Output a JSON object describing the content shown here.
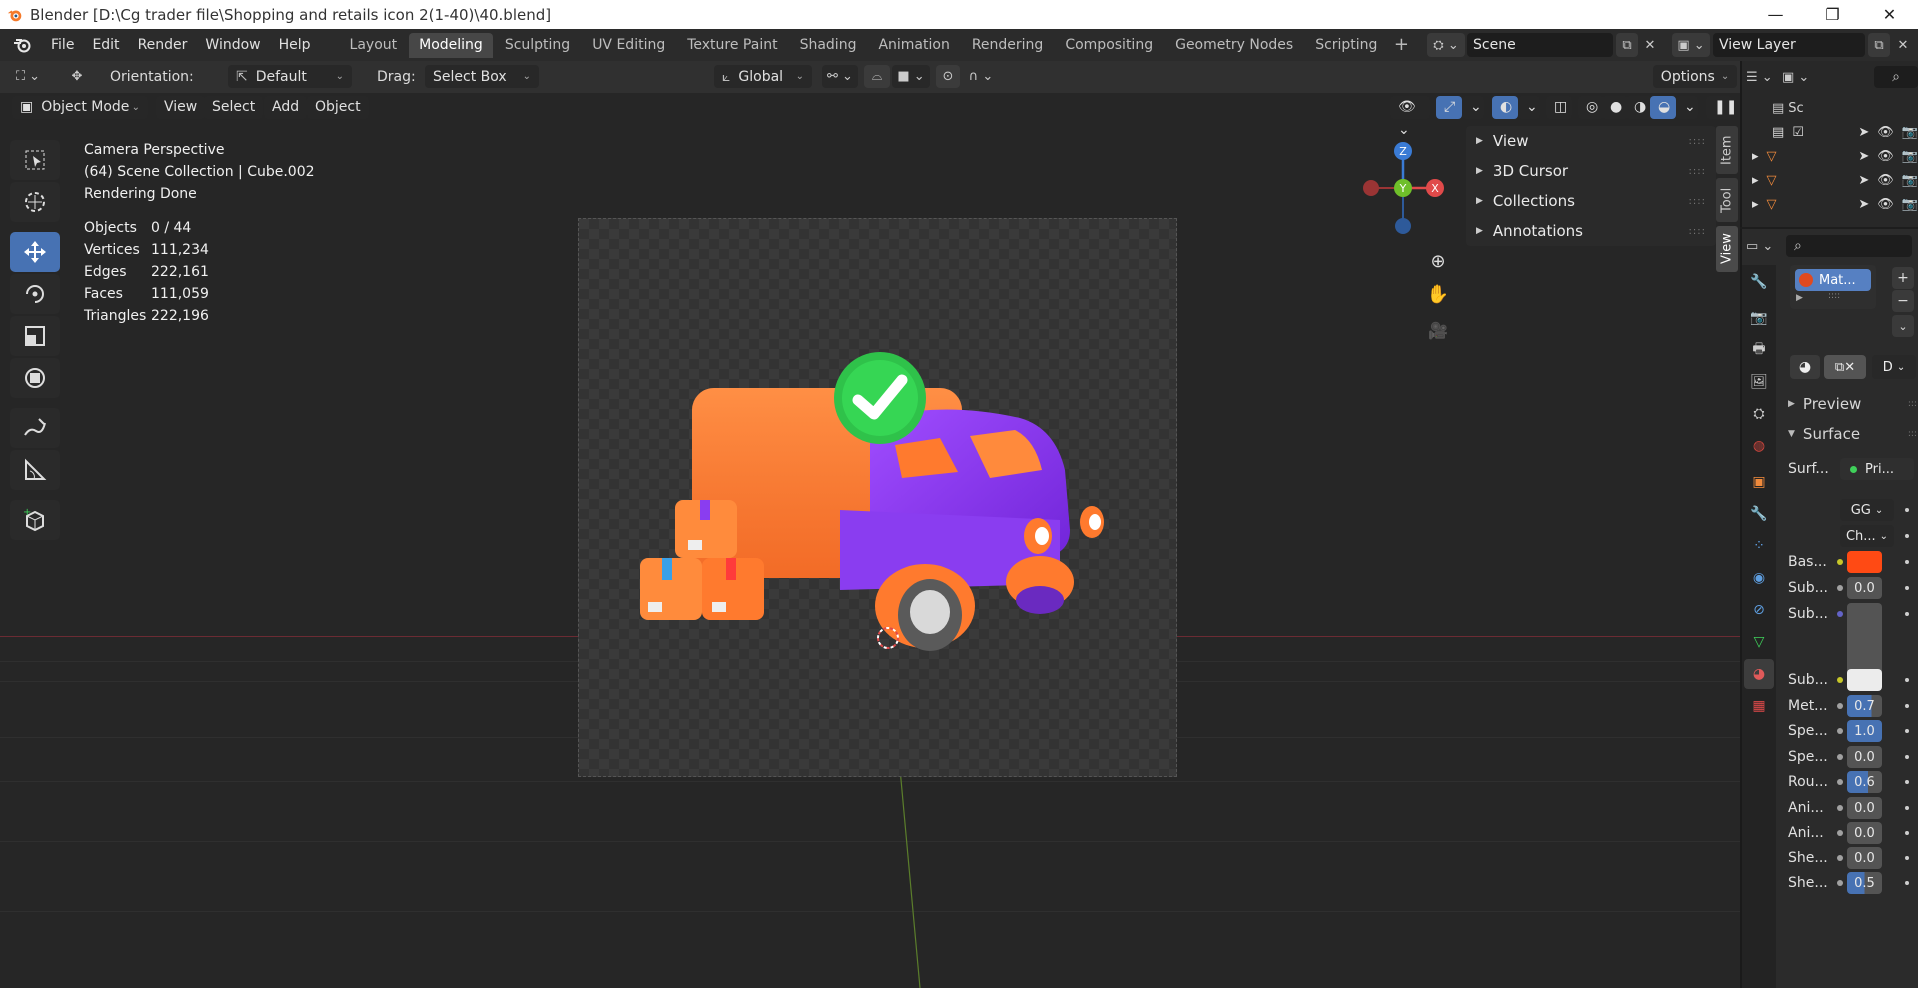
{
  "window": {
    "title": "Blender [D:\\Cg trader file\\Shopping and retails icon 2(1-40)\\40.blend]",
    "controls": [
      "—",
      "❐",
      "✕"
    ]
  },
  "menu": [
    "File",
    "Edit",
    "Render",
    "Window",
    "Help"
  ],
  "workspaces": [
    "Layout",
    "Modeling",
    "Sculpting",
    "UV Editing",
    "Texture Paint",
    "Shading",
    "Animation",
    "Rendering",
    "Compositing",
    "Geometry Nodes",
    "Scripting"
  ],
  "active_workspace": "Modeling",
  "scene": {
    "name": "Scene",
    "view_layer": "View Layer"
  },
  "tool_header": {
    "orientation_label": "Orientation:",
    "orientation_value": "Default",
    "drag_label": "Drag:",
    "drag_value": "Select Box",
    "transform_orientation": "Global",
    "options_label": "Options"
  },
  "viewport_header": {
    "mode": "Object Mode",
    "menus": [
      "View",
      "Select",
      "Add",
      "Object"
    ]
  },
  "overlay": {
    "line1": "Camera Perspective",
    "line2": "(64) Scene Collection | Cube.002",
    "line3": "Rendering Done"
  },
  "stats": [
    {
      "label": "Objects",
      "value": "0 / 44"
    },
    {
      "label": "Vertices",
      "value": "111,234"
    },
    {
      "label": "Edges",
      "value": "222,161"
    },
    {
      "label": "Faces",
      "value": "111,059"
    },
    {
      "label": "Triangles",
      "value": "222,196"
    }
  ],
  "npanel": {
    "items": [
      "View",
      "3D Cursor",
      "Collections",
      "Annotations"
    ],
    "tabs": [
      "Item",
      "Tool",
      "View"
    ]
  },
  "gizmo": {
    "x": "X",
    "y": "Y",
    "z": "Z"
  },
  "outliner": {
    "first_label": "Sc"
  },
  "material": {
    "slot_name": "Mat...",
    "data_label": "D",
    "sections": {
      "preview": "Preview",
      "surface": "Surface"
    },
    "surface_label": "Surf...",
    "surface_value": "Pri...",
    "gg_value": "GG",
    "ch_value": "Ch...",
    "rows": [
      {
        "label": "Bas...",
        "value": "",
        "kind": "color",
        "color": "#ff4a14"
      },
      {
        "label": "Sub...",
        "value": "0.0",
        "kind": "num"
      },
      {
        "label": "Sub...",
        "value": "",
        "kind": "vector"
      },
      {
        "label": "Sub...",
        "value": "",
        "kind": "color",
        "color": "#ececec"
      },
      {
        "label": "Met...",
        "value": "0.7",
        "kind": "fill",
        "fill": 0.7
      },
      {
        "label": "Spe...",
        "value": "1.0",
        "kind": "fill",
        "fill": 1.0
      },
      {
        "label": "Spe...",
        "value": "0.0",
        "kind": "num"
      },
      {
        "label": "Rou...",
        "value": "0.6",
        "kind": "fill",
        "fill": 0.6
      },
      {
        "label": "Ani...",
        "value": "0.0",
        "kind": "num"
      },
      {
        "label": "Ani...",
        "value": "0.0",
        "kind": "num"
      },
      {
        "label": "She...",
        "value": "0.0",
        "kind": "num"
      },
      {
        "label": "She...",
        "value": "0.5",
        "kind": "fill",
        "fill": 0.5
      }
    ]
  },
  "colors": {
    "accent": "#4772b3",
    "truck_body": "#8a3df0",
    "truck_box": "#ff7a2e",
    "check_badge": "#2fc24a"
  }
}
